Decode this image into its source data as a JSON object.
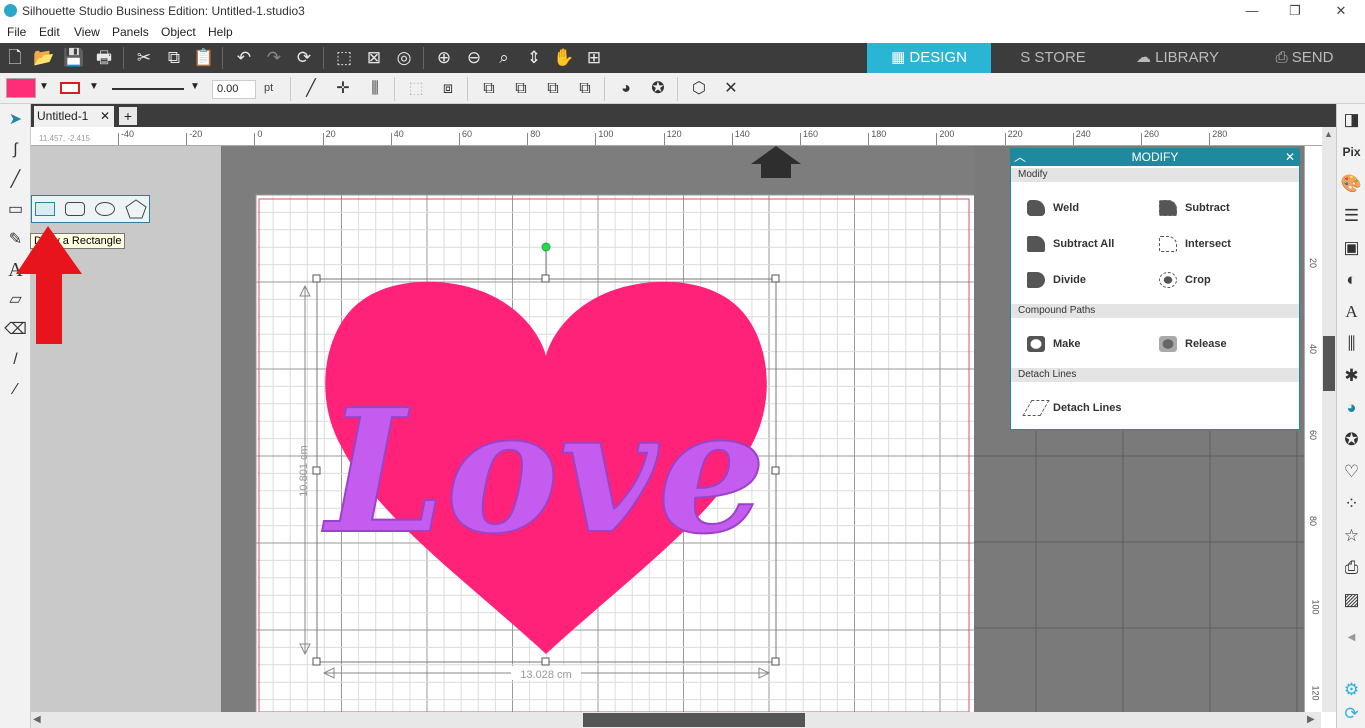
{
  "window": {
    "title": "Silhouette Studio Business Edition: Untitled-1.studio3",
    "minimize": "—",
    "restore": "❐",
    "close": "✕"
  },
  "menu": [
    "File",
    "Edit",
    "View",
    "Panels",
    "Object",
    "Help"
  ],
  "nav": {
    "design": "DESIGN",
    "store": "STORE",
    "library": "LIBRARY",
    "send": "SEND"
  },
  "style_bar": {
    "fill_color": "#ff2d78",
    "line_color": "#d62020",
    "line_width": "0.00",
    "unit": "pt"
  },
  "document": {
    "tab": "Untitled-1",
    "add": "+"
  },
  "ruler": {
    "coord": "11.457, -2.415",
    "h_labels": [
      "-40",
      "-20",
      "0",
      "20",
      "40",
      "60",
      "80",
      "100",
      "120",
      "140",
      "160",
      "180",
      "200",
      "220",
      "240",
      "260",
      "280"
    ],
    "v_labels": [
      "20",
      "40",
      "60",
      "80",
      "100",
      "120"
    ]
  },
  "tooltip": "Draw a Rectangle",
  "selection": {
    "height": "10.801 cm",
    "width": "13.028 cm"
  },
  "design": {
    "text": "Love",
    "heart_color": "#ff2278",
    "text_color": "#c45cf0"
  },
  "modify": {
    "title": "MODIFY",
    "sections": {
      "modify": "Modify",
      "compound": "Compound Paths",
      "detach": "Detach Lines"
    },
    "buttons": {
      "weld": "Weld",
      "subtract": "Subtract",
      "subtract_all": "Subtract All",
      "intersect": "Intersect",
      "divide": "Divide",
      "crop": "Crop",
      "make": "Make",
      "release": "Release",
      "detach_lines": "Detach Lines"
    }
  },
  "colors": {
    "accent": "#2bb5d5",
    "panel_header": "#1f8a9f",
    "toolbar_dark": "#3c3c3c",
    "arrow_annotation": "#e8141c"
  }
}
